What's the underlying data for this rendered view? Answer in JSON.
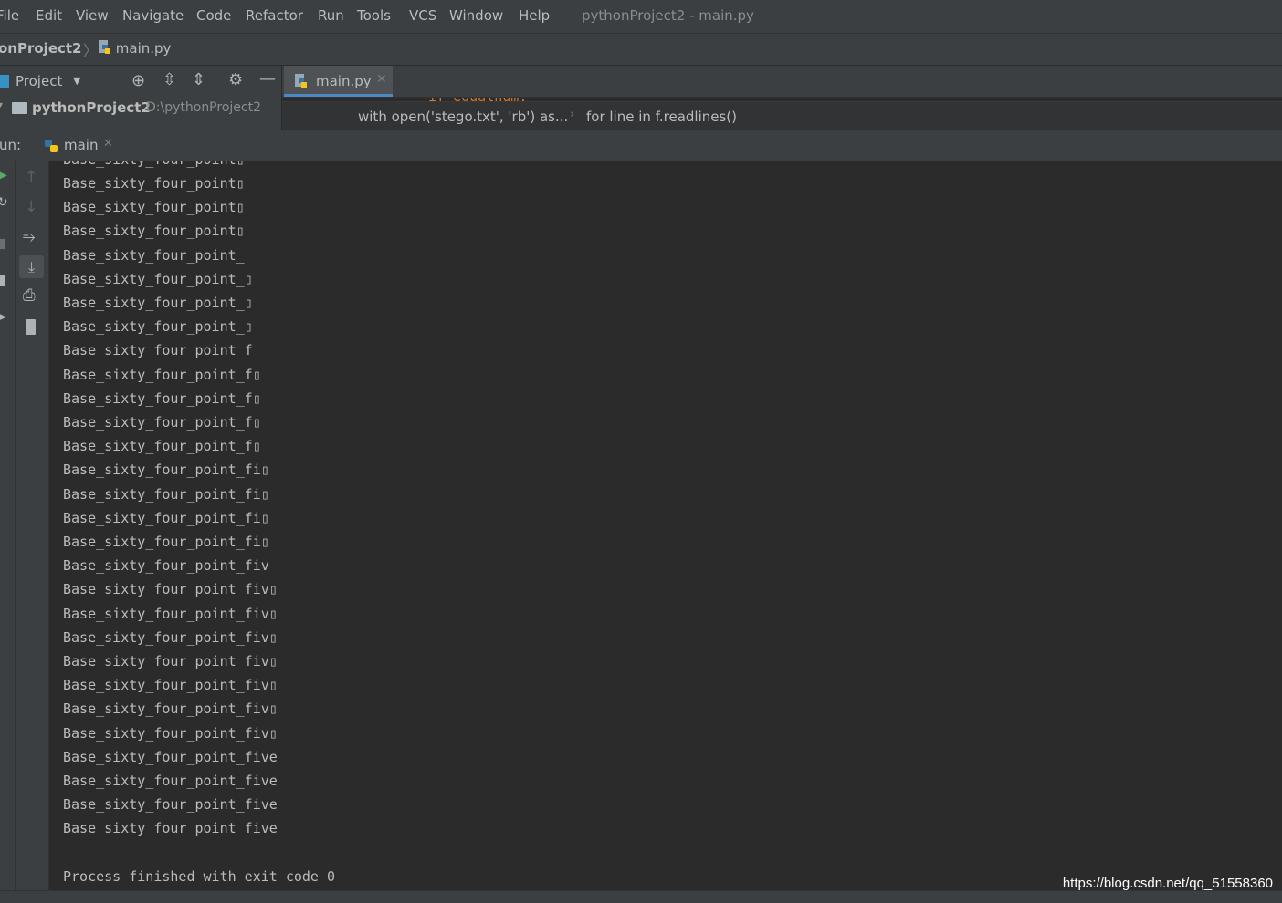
{
  "menu": {
    "items": [
      "File",
      "Edit",
      "View",
      "Navigate",
      "Code",
      "Refactor",
      "Run",
      "Tools",
      "VCS",
      "Window",
      "Help"
    ],
    "window_title": "pythonProject2 - main.py"
  },
  "navbar": {
    "project": "onProject2",
    "file": "main.py"
  },
  "project_panel": {
    "title": "Project",
    "root_name": "pythonProject2",
    "root_path": "D:\\pythonProject2"
  },
  "editor": {
    "tab_label": "main.py",
    "code_peek": "if equalnum:",
    "breadcrumb": [
      "with open('stego.txt', 'rb') as...",
      "for line in f.readlines()"
    ]
  },
  "run_panel": {
    "label": "un:",
    "tab_label": "main"
  },
  "console": {
    "lines": [
      "Base_sixty_four_point▯",
      "Base_sixty_four_point▯",
      "Base_sixty_four_point▯",
      "Base_sixty_four_point_",
      "Base_sixty_four_point_▯",
      "Base_sixty_four_point_▯",
      "Base_sixty_four_point_▯",
      "Base_sixty_four_point_f",
      "Base_sixty_four_point_f▯",
      "Base_sixty_four_point_f▯",
      "Base_sixty_four_point_f▯",
      "Base_sixty_four_point_f▯",
      "Base_sixty_four_point_fi▯",
      "Base_sixty_four_point_fi▯",
      "Base_sixty_four_point_fi▯",
      "Base_sixty_four_point_fi▯",
      "Base_sixty_four_point_fiv",
      "Base_sixty_four_point_fiv▯",
      "Base_sixty_four_point_fiv▯",
      "Base_sixty_four_point_fiv▯",
      "Base_sixty_four_point_fiv▯",
      "Base_sixty_four_point_fiv▯",
      "Base_sixty_four_point_fiv▯",
      "Base_sixty_four_point_fiv▯",
      "Base_sixty_four_point_five",
      "Base_sixty_four_point_five",
      "Base_sixty_four_point_five",
      "Base_sixty_four_point_five"
    ],
    "exit_message": "Process finished with exit code 0"
  },
  "watermark": "https://blog.csdn.net/qq_51558360",
  "colors": {
    "background": "#2b2b2b",
    "panel": "#3c3f41",
    "accent": "#4a88c7",
    "text": "#bbbbbb"
  }
}
